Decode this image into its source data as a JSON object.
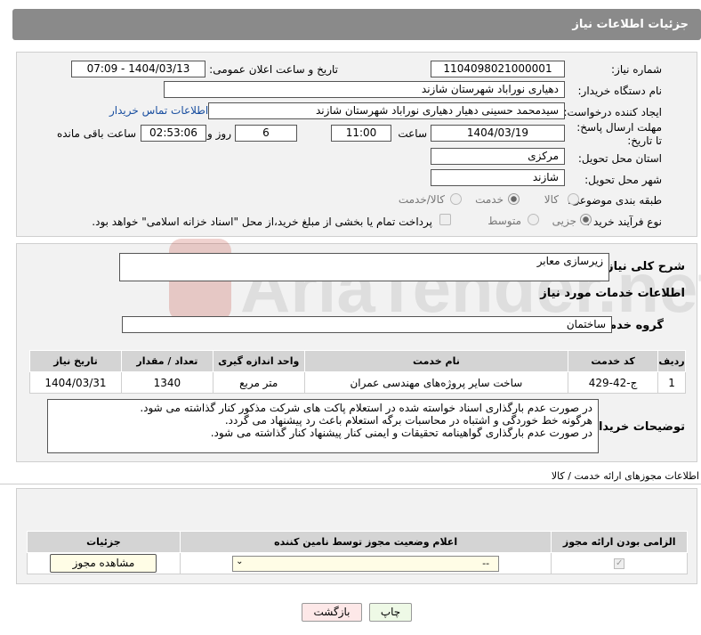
{
  "header": {
    "title": "جزئیات اطلاعات نیاز"
  },
  "need_number": {
    "label": "شماره نیاز:",
    "value": "1104098021000001"
  },
  "announce": {
    "label": "تاریخ و ساعت اعلان عمومی:",
    "value": "1404/03/13 - 07:09"
  },
  "buyer": {
    "label": "نام دستگاه خریدار:",
    "value": "دهیاری نوراباد شهرستان شازند"
  },
  "requester": {
    "label": "ایجاد کننده درخواست:",
    "value": "سیدمحمد حسینی دهیار دهیاری نوراباد شهرستان شازند",
    "contact_link": "اطلاعات تماس خریدار"
  },
  "deadline": {
    "label": "مهلت ارسال پاسخ: تا تاریخ:",
    "date": "1404/03/19",
    "time_label": "ساعت",
    "time": "11:00",
    "days": "6",
    "days_label": "روز و",
    "remaining": "02:53:06",
    "remaining_label": "ساعت باقی مانده"
  },
  "province": {
    "label": "استان محل تحویل:",
    "value": "مرکزی"
  },
  "city": {
    "label": "شهر محل تحویل:",
    "value": "شازند"
  },
  "category": {
    "label": "طبقه بندی موضوعی:",
    "options": [
      "کالا",
      "خدمت",
      "کالا/خدمت"
    ],
    "selected": "خدمت"
  },
  "process": {
    "label": "نوع فرآیند خرید :",
    "options": [
      "جزیی",
      "متوسط"
    ],
    "selected": "جزیی",
    "note": "پرداخت تمام یا بخشی از مبلغ خرید،از محل \"اسناد خزانه اسلامی\" خواهد بود."
  },
  "summary": {
    "label": "شرح کلی نیاز:",
    "value": "زیرسازی معابر"
  },
  "services_title": "اطلاعات خدمات مورد نیاز",
  "service_group": {
    "label": "گروه خدمت:",
    "value": "ساختمان"
  },
  "table": {
    "headers": [
      "ردیف",
      "کد خدمت",
      "نام خدمت",
      "واحد اندازه گیری",
      "تعداد / مقدار",
      "تاریخ نیاز"
    ],
    "rows": [
      [
        "1",
        "ج-42-429",
        "ساخت سایر پروژه‌های مهندسی عمران",
        "متر مربع",
        "1340",
        "1404/03/31"
      ]
    ]
  },
  "buyer_notes": {
    "label": "توضیحات خریدار:",
    "lines": [
      "در صورت عدم بارگذاری اسناد خواسته شده در استعلام پاکت های شرکت مذکور کنار گذاشته می شود.",
      "هرگونه خط خوردگی و اشتباه در محاسبات برگه استعلام باعث رد پیشنهاد می گردد.",
      "در صورت عدم بارگذاری گواهینامه تحقیقات و ایمنی کنار پیشنهاد کنار گذاشته می شود."
    ]
  },
  "permits": {
    "title": "اطلاعات مجوزهای ارائه خدمت / کالا",
    "headers": [
      "الزامی بودن ارائه مجوز",
      "اعلام وضعیت مجوز توسط نامین کننده",
      "جزئیات"
    ],
    "select_value": "--",
    "view_button": "مشاهده مجوز"
  },
  "buttons": {
    "print": "چاپ",
    "back": "بازگشت"
  },
  "watermark": {
    "text": "AriaTender.net"
  }
}
